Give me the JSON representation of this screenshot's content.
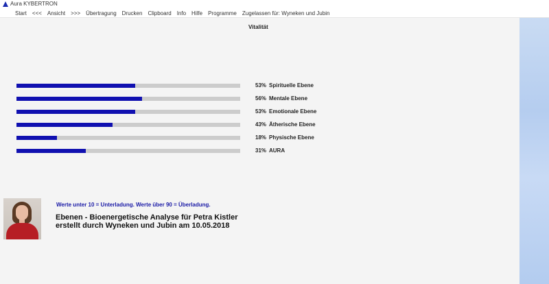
{
  "window": {
    "title": "Aura KYBERTRON"
  },
  "menu": [
    "Start",
    "<<<",
    "Ansicht",
    ">>>",
    "Übertragung",
    "Drucken",
    "Clipboard",
    "Info",
    "Hilfe",
    "Programme",
    "Zugelassen für: Wyneken und Jubin"
  ],
  "page_title": "Vitalität",
  "levels": [
    {
      "percent": 53,
      "percent_label": "53%",
      "label": "Spirituelle Ebene"
    },
    {
      "percent": 56,
      "percent_label": "56%",
      "label": "Mentale Ebene"
    },
    {
      "percent": 53,
      "percent_label": "53%",
      "label": "Emotionale Ebene"
    },
    {
      "percent": 43,
      "percent_label": "43%",
      "label": "Ätherische Ebene"
    },
    {
      "percent": 18,
      "percent_label": "18%",
      "label": "Physische Ebene"
    },
    {
      "percent": 31,
      "percent_label": "31%",
      "label": "AURA"
    }
  ],
  "note": "Werte unter 10 = Unterladung. Werte über 90 = Überladung.",
  "report": {
    "line1": "Ebenen - Bioenergetische Analyse für Petra Kistler",
    "line2": "erstellt durch Wyneken und Jubin am 10.05.2018"
  },
  "colors": {
    "bar_fill": "#1010b0",
    "bar_track": "#cccccc",
    "note_text": "#1a1aa6",
    "side_panel": "#c2d6f2"
  }
}
